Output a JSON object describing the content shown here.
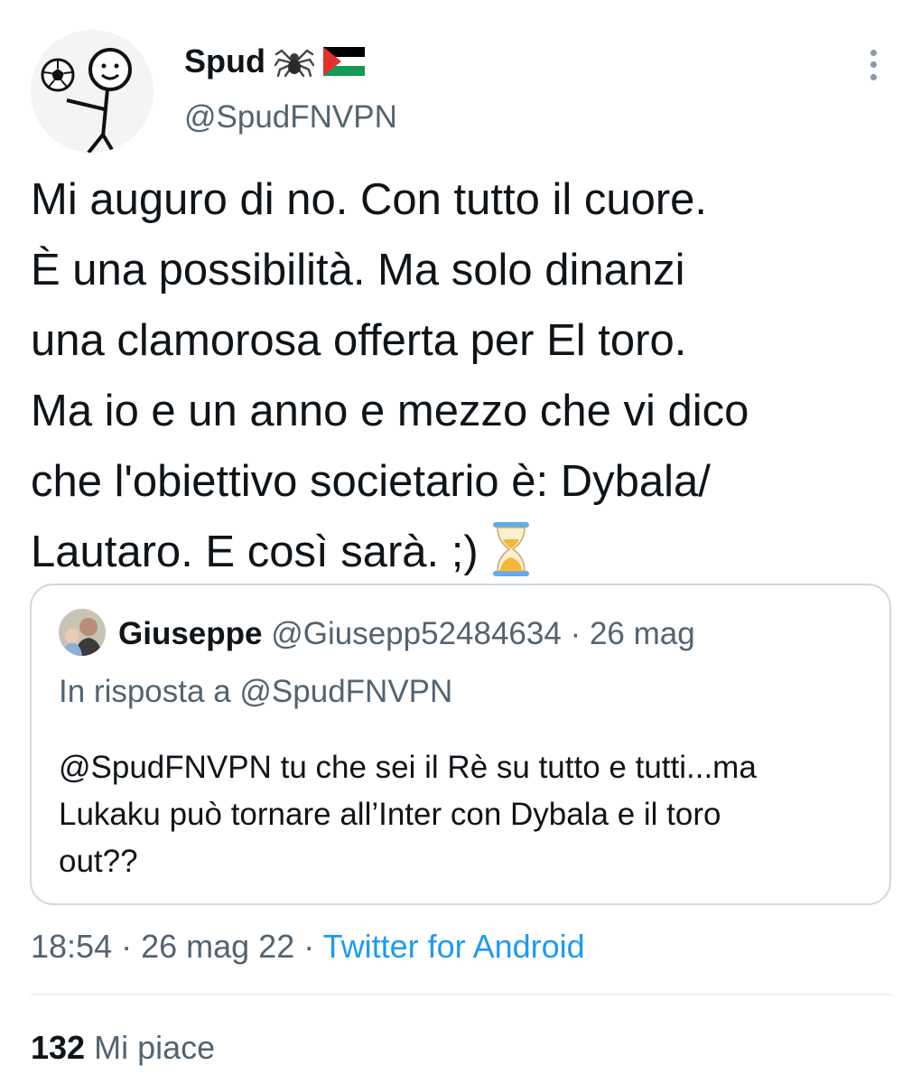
{
  "author": {
    "name": "Spud",
    "handle": "@SpudFNVPN",
    "icons": [
      "spider-emoji",
      "palestine-flag-emoji"
    ]
  },
  "tweet": {
    "text": "Mi auguro di no. Con tutto il cuore.\nÈ una possibilità. Ma solo dinanzi\nuna clamorosa offerta per El toro.\nMa io e un anno e mezzo che vi dico\nche l'obiettivo societario è: Dybala/\nLautaro. E così sarà. ;)",
    "trailing_icon": "hourglass-emoji"
  },
  "quoted_tweet": {
    "name": "Giuseppe",
    "handle": "@Giusepp52484634",
    "date": "26 mag",
    "separator": " · ",
    "reply_prefix": "In risposta a ",
    "reply_handle": "@SpudFNVPN",
    "text": "@SpudFNVPN tu che sei il Rè su tutto e tutti...ma\nLukaku può tornare all’Inter con Dybala e il toro\nout??"
  },
  "meta": {
    "time": "18:54",
    "date": "26 mag 22",
    "separator": " · ",
    "source": "Twitter for Android"
  },
  "stats": {
    "likes_count": "132",
    "likes_label": " Mi piace"
  },
  "colors": {
    "text": "#0f1419",
    "secondary": "#536471",
    "link": "#1d9bf0",
    "border": "#cfd9de"
  }
}
